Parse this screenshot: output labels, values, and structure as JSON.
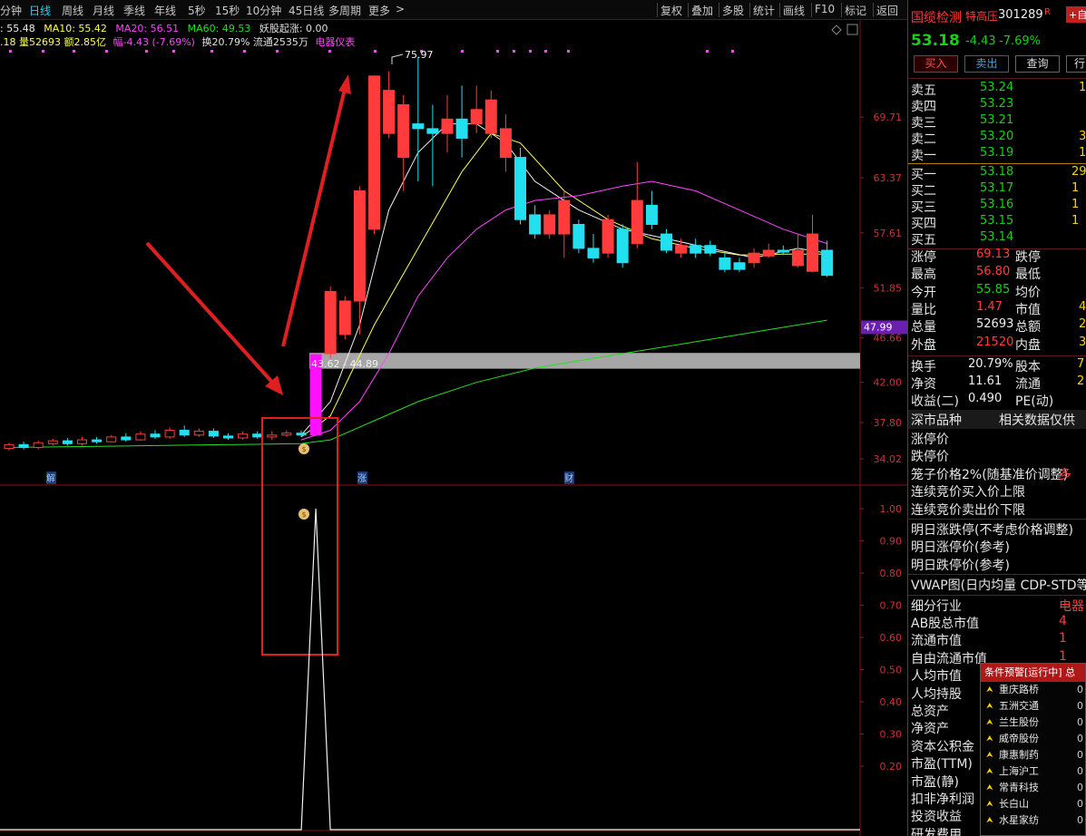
{
  "toolbar": {
    "periods": [
      "分钟",
      "日线",
      "周线",
      "月线",
      "季线",
      "年线",
      "5秒",
      "15秒",
      "10分钟",
      "45日线",
      "多周期",
      "更多"
    ],
    "active_period": "日线",
    "more_arrow": ">",
    "tools": [
      "复权",
      "叠加",
      "多股",
      "统计",
      "画线",
      "F10",
      "标记",
      "返回"
    ]
  },
  "indicators": {
    "ma5": ": 55.48",
    "ma10": "MA10: 55.42",
    "ma20": "MA20: 56.51",
    "ma60": "MA60: 49.53",
    "signal": "妖股起涨: 0.00",
    "volume_line": ".18 量52693 额2.85亿",
    "change": "幅-4.43 (-7.69%)",
    "turnover": "换20.79% 流通2535万",
    "industry": "电器仪表",
    "colors": {
      "ma5": "#f0f0f0",
      "ma10": "#ffff55",
      "ma20": "#ff44ff",
      "ma60": "#22e022",
      "signal": "#e0e0e0",
      "volume": "#ffff55",
      "change": "#ff44ff",
      "industry": "#ff44ff"
    }
  },
  "price_axis": {
    "labels": [
      "69.71",
      "63.37",
      "57.61",
      "51.85",
      "46.66",
      "42.00",
      "37.80",
      "34.02"
    ],
    "current_tag": "47.99"
  },
  "chart_labels": {
    "peak_price": "75.97",
    "gap_band": "43.62 - 44.89",
    "markers": [
      "解",
      "涨",
      "财"
    ]
  },
  "sub_axis": {
    "labels": [
      "1.00",
      "0.90",
      "0.80",
      "0.70",
      "0.60",
      "0.50",
      "0.40",
      "0.30",
      "0.20"
    ]
  },
  "chart_data": {
    "type": "candlestick",
    "xlabel": "",
    "ylabel": "",
    "ylim": [
      34.02,
      75.97
    ],
    "candles": [
      {
        "o": 35.1,
        "c": 35.5,
        "h": 35.7,
        "l": 34.9
      },
      {
        "o": 35.5,
        "c": 35.2,
        "h": 35.8,
        "l": 35.0
      },
      {
        "o": 35.2,
        "c": 35.7,
        "h": 35.9,
        "l": 35.0
      },
      {
        "o": 35.6,
        "c": 35.9,
        "h": 36.1,
        "l": 35.4
      },
      {
        "o": 35.9,
        "c": 35.6,
        "h": 36.2,
        "l": 35.4
      },
      {
        "o": 35.6,
        "c": 36.0,
        "h": 36.3,
        "l": 35.4
      },
      {
        "o": 36.0,
        "c": 35.8,
        "h": 36.3,
        "l": 35.6
      },
      {
        "o": 35.8,
        "c": 36.3,
        "h": 36.5,
        "l": 35.7
      },
      {
        "o": 36.3,
        "c": 36.0,
        "h": 36.7,
        "l": 35.8
      },
      {
        "o": 36.0,
        "c": 36.6,
        "h": 36.9,
        "l": 35.9
      },
      {
        "o": 36.6,
        "c": 36.3,
        "h": 37.0,
        "l": 36.1
      },
      {
        "o": 36.3,
        "c": 37.0,
        "h": 37.3,
        "l": 36.1
      },
      {
        "o": 37.0,
        "c": 36.5,
        "h": 37.5,
        "l": 36.3
      },
      {
        "o": 36.5,
        "c": 36.9,
        "h": 37.2,
        "l": 36.3
      },
      {
        "o": 36.9,
        "c": 36.4,
        "h": 37.2,
        "l": 36.2
      },
      {
        "o": 36.4,
        "c": 36.2,
        "h": 36.7,
        "l": 36.0
      },
      {
        "o": 36.2,
        "c": 36.6,
        "h": 36.9,
        "l": 36.0
      },
      {
        "o": 36.6,
        "c": 36.3,
        "h": 36.9,
        "l": 36.1
      },
      {
        "o": 36.3,
        "c": 36.5,
        "h": 36.9,
        "l": 36.0
      },
      {
        "o": 36.5,
        "c": 36.7,
        "h": 37.0,
        "l": 36.3
      },
      {
        "o": 36.7,
        "c": 36.5,
        "h": 37.0,
        "l": 36.3
      },
      {
        "o": 36.5,
        "c": 44.9,
        "h": 44.9,
        "l": 36.4
      },
      {
        "o": 45.0,
        "c": 51.5,
        "h": 52.0,
        "l": 44.5
      },
      {
        "o": 47.0,
        "c": 50.5,
        "h": 51.0,
        "l": 46.5
      },
      {
        "o": 50.5,
        "c": 62.0,
        "h": 62.5,
        "l": 47.0
      },
      {
        "o": 58.0,
        "c": 74.0,
        "h": 74.0,
        "l": 57.5
      },
      {
        "o": 68.0,
        "c": 72.5,
        "h": 74.5,
        "l": 67.5
      },
      {
        "o": 65.5,
        "c": 71.0,
        "h": 72.0,
        "l": 62.0
      },
      {
        "o": 69.0,
        "c": 68.5,
        "h": 75.97,
        "l": 63.0
      },
      {
        "o": 68.5,
        "c": 68.0,
        "h": 71.0,
        "l": 62.5
      },
      {
        "o": 68.0,
        "c": 69.5,
        "h": 72.0,
        "l": 66.0
      },
      {
        "o": 69.5,
        "c": 67.5,
        "h": 73.0,
        "l": 65.5
      },
      {
        "o": 69.0,
        "c": 70.5,
        "h": 73.0,
        "l": 68.0
      },
      {
        "o": 68.0,
        "c": 71.5,
        "h": 72.5,
        "l": 67.5
      },
      {
        "o": 65.5,
        "c": 68.5,
        "h": 70.0,
        "l": 64.0
      },
      {
        "o": 65.5,
        "c": 59.0,
        "h": 66.5,
        "l": 58.5
      },
      {
        "o": 59.5,
        "c": 57.5,
        "h": 60.5,
        "l": 57.0
      },
      {
        "o": 57.5,
        "c": 59.5,
        "h": 60.0,
        "l": 57.0
      },
      {
        "o": 57.5,
        "c": 61.0,
        "h": 62.0,
        "l": 55.0
      },
      {
        "o": 58.5,
        "c": 56.0,
        "h": 59.0,
        "l": 55.5
      },
      {
        "o": 56.0,
        "c": 55.0,
        "h": 57.5,
        "l": 54.5
      },
      {
        "o": 55.5,
        "c": 59.0,
        "h": 59.5,
        "l": 55.0
      },
      {
        "o": 58.0,
        "c": 54.5,
        "h": 58.5,
        "l": 54.0
      },
      {
        "o": 56.5,
        "c": 61.0,
        "h": 65.0,
        "l": 56.0
      },
      {
        "o": 60.5,
        "c": 58.5,
        "h": 62.0,
        "l": 58.0
      },
      {
        "o": 57.5,
        "c": 55.8,
        "h": 58.0,
        "l": 55.5
      },
      {
        "o": 55.5,
        "c": 56.3,
        "h": 57.0,
        "l": 55.0
      },
      {
        "o": 56.3,
        "c": 55.5,
        "h": 57.0,
        "l": 55.0
      },
      {
        "o": 56.3,
        "c": 55.5,
        "h": 56.8,
        "l": 55.2
      },
      {
        "o": 55.0,
        "c": 53.8,
        "h": 55.5,
        "l": 53.5
      },
      {
        "o": 54.5,
        "c": 53.8,
        "h": 55.0,
        "l": 53.5
      },
      {
        "o": 54.5,
        "c": 55.5,
        "h": 56.0,
        "l": 54.0
      },
      {
        "o": 55.2,
        "c": 55.8,
        "h": 56.5,
        "l": 55.0
      },
      {
        "o": 55.8,
        "c": 55.6,
        "h": 56.3,
        "l": 55.3
      },
      {
        "o": 54.2,
        "c": 55.8,
        "h": 57.5,
        "l": 54.0
      },
      {
        "o": 53.6,
        "c": 57.5,
        "h": 59.5,
        "l": 53.5
      },
      {
        "o": 55.8,
        "c": 53.18,
        "h": 56.8,
        "l": 53.0
      }
    ],
    "ma_series": [
      {
        "name": "MA10",
        "color": "#ffff55",
        "values": [
          [
            20,
            36.3
          ],
          [
            22,
            38.5
          ],
          [
            25,
            48
          ],
          [
            28,
            56
          ],
          [
            31,
            64
          ],
          [
            33,
            68
          ],
          [
            35,
            67
          ],
          [
            38,
            62
          ],
          [
            41,
            59
          ],
          [
            44,
            57
          ],
          [
            47,
            56
          ],
          [
            50,
            55.3
          ],
          [
            53,
            55.4
          ],
          [
            56,
            55.4
          ]
        ]
      },
      {
        "name": "MA5",
        "color": "#f0f0f0",
        "values": [
          [
            20,
            36.5
          ],
          [
            22,
            40
          ],
          [
            24,
            48
          ],
          [
            26,
            60
          ],
          [
            28,
            66
          ],
          [
            30,
            69
          ],
          [
            32,
            69
          ],
          [
            34,
            67
          ],
          [
            36,
            63
          ],
          [
            39,
            60
          ],
          [
            42,
            58
          ],
          [
            45,
            57
          ],
          [
            48,
            56
          ],
          [
            51,
            55
          ],
          [
            54,
            56
          ],
          [
            56,
            55.5
          ]
        ]
      },
      {
        "name": "MA20",
        "color": "#ff44ff",
        "values": [
          [
            20,
            36.0
          ],
          [
            22,
            37
          ],
          [
            24,
            40
          ],
          [
            26,
            45
          ],
          [
            28,
            51
          ],
          [
            30,
            55
          ],
          [
            32,
            58
          ],
          [
            34,
            60
          ],
          [
            36,
            61
          ],
          [
            39,
            61.5
          ],
          [
            42,
            62.5
          ],
          [
            44,
            63
          ],
          [
            47,
            62
          ],
          [
            50,
            60
          ],
          [
            53,
            58
          ],
          [
            56,
            56.5
          ]
        ]
      },
      {
        "name": "MA60",
        "color": "#22e022",
        "values": [
          [
            0,
            35.2
          ],
          [
            10,
            35.4
          ],
          [
            20,
            35.6
          ],
          [
            22,
            36
          ],
          [
            25,
            38
          ],
          [
            28,
            40
          ],
          [
            32,
            42
          ],
          [
            36,
            43.5
          ],
          [
            40,
            44.5
          ],
          [
            44,
            45.5
          ],
          [
            48,
            46.5
          ],
          [
            52,
            47.5
          ],
          [
            56,
            48.5
          ]
        ]
      }
    ],
    "gap_band": [
      43.62,
      44.89
    ],
    "sub_indicator": {
      "name": "妖股起涨",
      "ylim": [
        0,
        1
      ],
      "signal_index": 21,
      "signal_value": 1.0
    }
  },
  "stock": {
    "name": "国缆检测",
    "tag": "特高压",
    "code": "301289",
    "code_mark": "R",
    "plus_button": "+自",
    "price": "53.18",
    "change": "-4.43",
    "change_pct": "-7.69%"
  },
  "trade_buttons": [
    "买入",
    "卖出",
    "查询",
    "行"
  ],
  "order_book": {
    "asks": [
      {
        "label": "卖五",
        "price": "53.24",
        "vol": "1"
      },
      {
        "label": "卖四",
        "price": "53.23",
        "vol": ""
      },
      {
        "label": "卖三",
        "price": "53.21",
        "vol": ""
      },
      {
        "label": "卖二",
        "price": "53.20",
        "vol": "3"
      },
      {
        "label": "卖一",
        "price": "53.19",
        "vol": "1"
      }
    ],
    "bids": [
      {
        "label": "买一",
        "price": "53.18",
        "vol": "29"
      },
      {
        "label": "买二",
        "price": "53.17",
        "vol": "1"
      },
      {
        "label": "买三",
        "price": "53.16",
        "vol": "1"
      },
      {
        "label": "买四",
        "price": "53.15",
        "vol": "1"
      },
      {
        "label": "买五",
        "price": "53.14",
        "vol": ""
      }
    ]
  },
  "stats": [
    {
      "l1": "涨停",
      "v1": "69.13",
      "c1": "red",
      "l2": "跌停",
      "v2": ""
    },
    {
      "l1": "最高",
      "v1": "56.80",
      "c1": "red",
      "l2": "最低",
      "v2": ""
    },
    {
      "l1": "今开",
      "v1": "55.85",
      "c1": "green",
      "l2": "均价",
      "v2": ""
    },
    {
      "l1": "量比",
      "v1": "1.47",
      "c1": "red",
      "l2": "市值",
      "v2": "4"
    },
    {
      "l1": "总量",
      "v1": "52693",
      "c1": "white",
      "l2": "总额",
      "v2": "2"
    },
    {
      "l1": "外盘",
      "v1": "21520",
      "c1": "red",
      "l2": "内盘",
      "v2": "3"
    }
  ],
  "stats2": [
    {
      "l1": "换手",
      "v1": "20.79%",
      "l2": "股本",
      "v2": "7"
    },
    {
      "l1": "净资",
      "v1": "11.61",
      "l2": "流通",
      "v2": "2"
    },
    {
      "l1": "收益(二)",
      "v1": "0.490",
      "l2": "PE(动)",
      "v2": ""
    }
  ],
  "section_titles": {
    "market": "深市品种",
    "related": "相关数据仅供"
  },
  "info_rows": [
    {
      "label": "涨停价",
      "value": ""
    },
    {
      "label": "跌停价",
      "value": ""
    },
    {
      "label": "笼子价格2%(随基准价调整)",
      "value": "多"
    },
    {
      "label": "连续竞价买入价上限",
      "value": ""
    },
    {
      "label": "连续竞价卖出价下限",
      "value": ""
    },
    {
      "label": "明日涨跌停(不考虑价格调整)",
      "value": ""
    },
    {
      "label": "明日涨停价(参考)",
      "value": ""
    },
    {
      "label": "明日跌停价(参考)",
      "value": ""
    },
    {
      "label": "VWAP图(日内均量 CDP-STD等",
      "value": ""
    },
    {
      "label": "细分行业",
      "value": "电器"
    },
    {
      "label": "AB股总市值",
      "value": "4"
    },
    {
      "label": "流通市值",
      "value": "1"
    },
    {
      "label": "自由流通市值",
      "value": "1"
    },
    {
      "label": "人均市值",
      "value": ""
    },
    {
      "label": "人均持股",
      "value": ""
    },
    {
      "label": "总资产",
      "value": ""
    },
    {
      "label": "净资产",
      "value": ""
    },
    {
      "label": "资本公积金",
      "value": ""
    },
    {
      "label": "市盈(TTM)",
      "value": ""
    },
    {
      "label": "市盈(静)",
      "value": ""
    },
    {
      "label": "扣非净利润",
      "value": ""
    },
    {
      "label": "投资收益",
      "value": ""
    },
    {
      "label": "研发费用",
      "value": ""
    }
  ],
  "alert_popup": {
    "title": "条件预警[运行中] 总",
    "items": [
      {
        "name": "重庆路桥",
        "v": "0"
      },
      {
        "name": "五洲交通",
        "v": "0"
      },
      {
        "name": "兰生股份",
        "v": "0"
      },
      {
        "name": "威帝股份",
        "v": "0"
      },
      {
        "name": "康惠制药",
        "v": "0"
      },
      {
        "name": "上海沪工",
        "v": "0"
      },
      {
        "name": "常青科技",
        "v": "0"
      },
      {
        "name": "长白山",
        "v": "0"
      },
      {
        "name": "水星家纺",
        "v": "0"
      }
    ]
  }
}
